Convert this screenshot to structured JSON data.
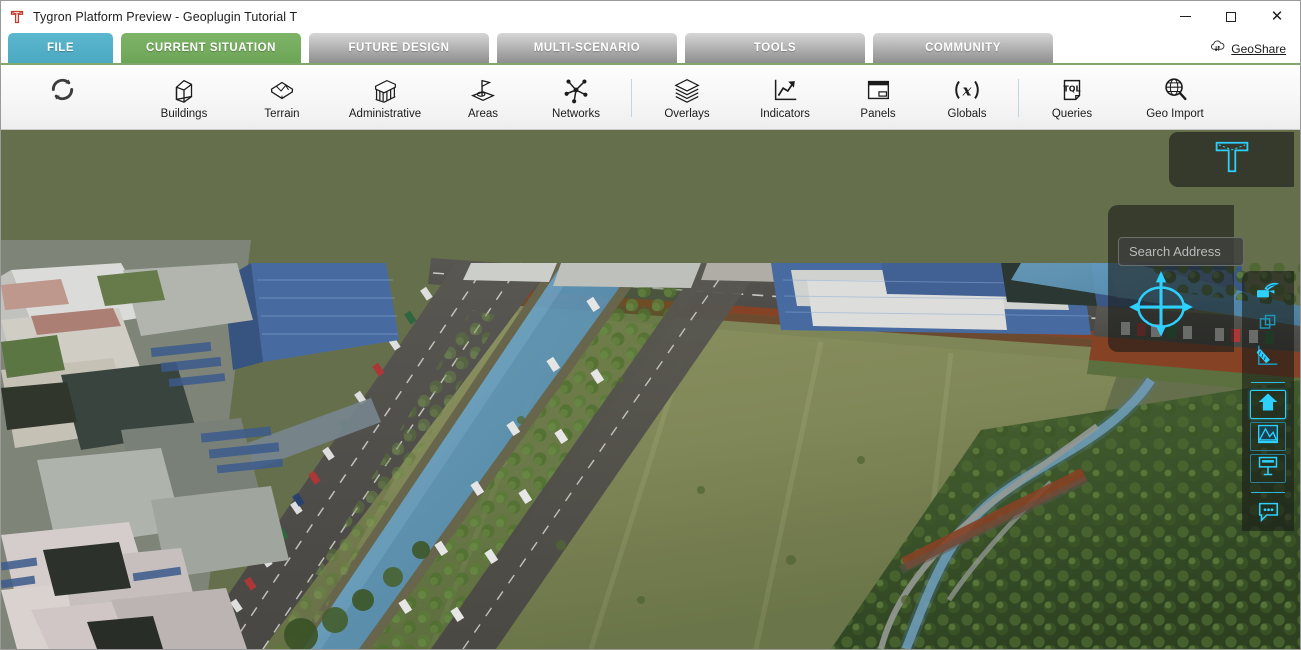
{
  "window": {
    "title": "Tygron Platform Preview - Geoplugin Tutorial T",
    "app_icon": "tygron-t-logo",
    "minimize_label": "—",
    "maximize_label": "□",
    "close_label": "✕"
  },
  "tabs": [
    {
      "id": "file",
      "label": "FILE",
      "state": "file"
    },
    {
      "id": "current-situation",
      "label": "CURRENT SITUATION",
      "state": "active"
    },
    {
      "id": "future-design",
      "label": "FUTURE DESIGN",
      "state": "plain"
    },
    {
      "id": "multi-scenario",
      "label": "MULTI-SCENARIO",
      "state": "plain"
    },
    {
      "id": "tools",
      "label": "TOOLS",
      "state": "plain"
    },
    {
      "id": "community",
      "label": "COMMUNITY",
      "state": "plain"
    }
  ],
  "geoshare": {
    "label": "GeoShare",
    "icon": "cloud-upload-download-icon"
  },
  "ribbon": {
    "refresh": {
      "label": "",
      "icon": "refresh-circular-arrows-icon"
    },
    "items": [
      {
        "id": "buildings",
        "label": "Buildings",
        "icon": "building-3d-icon"
      },
      {
        "id": "terrain",
        "label": "Terrain",
        "icon": "terrain-3d-icon"
      },
      {
        "id": "administrative",
        "label": "Administrative",
        "icon": "administrative-building-icon"
      },
      {
        "id": "areas",
        "label": "Areas",
        "icon": "area-flag-icon"
      },
      {
        "id": "networks",
        "label": "Networks",
        "icon": "network-nodes-icon"
      },
      {
        "id": "overlays",
        "label": "Overlays",
        "icon": "layers-stack-icon"
      },
      {
        "id": "indicators",
        "label": "Indicators",
        "icon": "trend-arrow-chart-icon"
      },
      {
        "id": "panels",
        "label": "Panels",
        "icon": "window-panel-icon"
      },
      {
        "id": "globals",
        "label": "Globals",
        "icon": "variable-x-icon"
      },
      {
        "id": "queries",
        "label": "Queries",
        "icon": "tql-document-icon"
      },
      {
        "id": "geo-import",
        "label": "Geo Import",
        "icon": "globe-magnifier-icon"
      }
    ]
  },
  "hud": {
    "logo_icon": "tygron-t-outline-icon",
    "search": {
      "placeholder": "Search Address",
      "value": "Search Address"
    },
    "compass": {
      "icon": "compass-navigation-icon"
    },
    "rail": [
      {
        "id": "fly-camera",
        "icon": "flying-camera-icon",
        "state": "plain"
      },
      {
        "id": "duplicate",
        "icon": "copy-layers-icon",
        "state": "plain"
      },
      {
        "id": "measure",
        "icon": "measure-ruler-icon",
        "state": "plain"
      },
      {
        "id": "buildings-view",
        "icon": "home-building-icon",
        "state": "sel"
      },
      {
        "id": "terrain-view",
        "icon": "terrain-image-icon",
        "state": "boxed"
      },
      {
        "id": "panels-view",
        "icon": "panel-board-icon",
        "state": "boxed"
      },
      {
        "id": "chat",
        "icon": "chat-bubble-icon",
        "state": "plain"
      }
    ]
  },
  "viewport": {
    "scene": "3d-aerial-city-view",
    "description": "Oblique 3D aerial rendering: dense urban blocks with buildings at upper-left and lower-left, a blue canal and multi-lane roads running diagonally, a large open green park field in the centre, and a wooded area with footpaths and a stream at lower-right.",
    "colors": {
      "grass_field": "#8a9161",
      "tree_canopy": "#5f7a3f",
      "water_canal": "#5f9ec4",
      "road_asphalt": "#56544f",
      "brick_path": "#7a3a25",
      "building_roof_light": "#d7d9d6",
      "building_glass_blue": "#3f5f93"
    }
  },
  "theme": {
    "tab_active": "#7fb468",
    "tab_file": "#5bb8cf",
    "tab_inactive": "#b4b4b4",
    "hud_accent": "#2ed0ff",
    "ribbon_bg": "#f6f6f6",
    "underline_green": "#7fa86a"
  }
}
